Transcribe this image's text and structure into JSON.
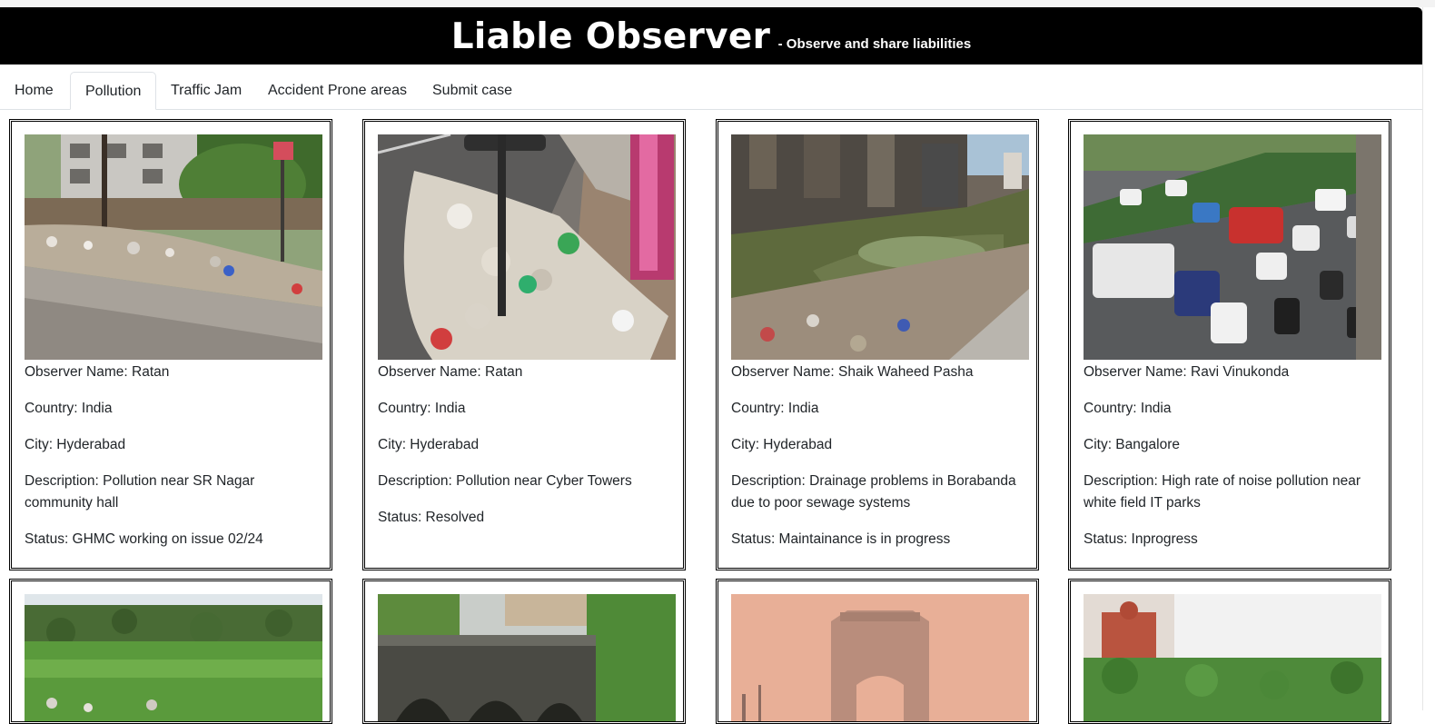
{
  "header": {
    "title": "Liable Observer",
    "tagline": "- Observe and share liabilities"
  },
  "nav": {
    "tabs": [
      {
        "label": "Home",
        "active": false
      },
      {
        "label": "Pollution",
        "active": true
      },
      {
        "label": "Traffic Jam",
        "active": false
      },
      {
        "label": "Accident Prone areas",
        "active": false
      },
      {
        "label": "Submit case",
        "active": false
      }
    ]
  },
  "cases": [
    {
      "observer": "Observer Name: Ratan",
      "country": "Country: India",
      "city": "City: Hyderabad",
      "description": "Description: Pollution near SR Nagar community hall",
      "status": "Status: GHMC working on issue 02/24",
      "image": "roadside-garbage-photo"
    },
    {
      "observer": "Observer Name: Ratan",
      "country": "Country: India",
      "city": "City: Hyderabad",
      "description": "Description: Pollution near Cyber Towers",
      "status": "Status: Resolved",
      "image": "garbage-pile-sidewalk-photo"
    },
    {
      "observer": "Observer Name: Shaik Waheed Pasha",
      "country": "Country: India",
      "city": "City: Hyderabad",
      "description": "Description: Drainage problems in Borabanda due to poor sewage systems",
      "status": "Status: Maintainance is in progress",
      "image": "polluted-drain-photo"
    },
    {
      "observer": "Observer Name: Ravi Vinukonda",
      "country": "Country: India",
      "city": "City: Bangalore",
      "description": "Description: High rate of noise pollution near white field IT parks",
      "status": "Status: Inprogress",
      "image": "traffic-jam-photo"
    },
    {
      "image": "green-field-photo"
    },
    {
      "image": "old-bridge-photo"
    },
    {
      "image": "smog-monument-photo"
    },
    {
      "image": "river-building-photo"
    }
  ]
}
